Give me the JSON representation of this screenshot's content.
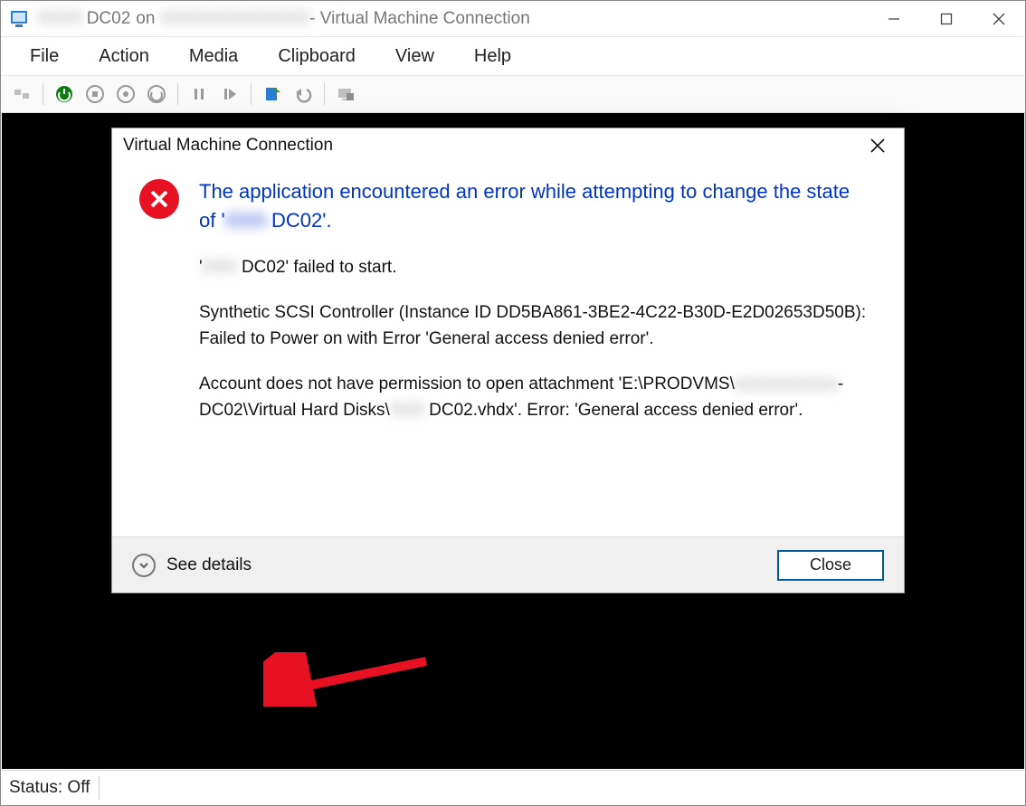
{
  "window": {
    "title_prefix_blur": "XXXX",
    "title_vm": "DC02",
    "title_on": "on",
    "title_host_blur": "XXXXXXXXXXXXX",
    "title_suffix": " - Virtual Machine Connection"
  },
  "menubar": {
    "items": [
      "File",
      "Action",
      "Media",
      "Clipboard",
      "View",
      "Help"
    ]
  },
  "statusbar": {
    "label": "Status: Off"
  },
  "dialog": {
    "title": "Virtual Machine Connection",
    "heading_pre": "The application encountered an error while attempting to change the state of '",
    "heading_blur": "XXX-",
    "heading_vm": "DC02",
    "heading_post": "'.",
    "p1_pre": "'",
    "p1_blur": "XXX",
    "p1_mid": " DC02' failed to start.",
    "p2": "Synthetic SCSI Controller (Instance ID DD5BA861-3BE2-4C22-B30D-E2D02653D50B): Failed to Power on with Error 'General access denied error'.",
    "p3_a": " Account does not have permission to open attachment 'E:\\PRODVMS\\",
    "p3_blur1": "xxxxxxxxxxxx",
    "p3_b": "-DC02\\Virtual Hard Disks\\",
    "p3_blur2": "XXX",
    "p3_c": " DC02.vhdx'. Error: 'General access denied error'.",
    "see_details": "See details",
    "close_btn": "Close"
  }
}
